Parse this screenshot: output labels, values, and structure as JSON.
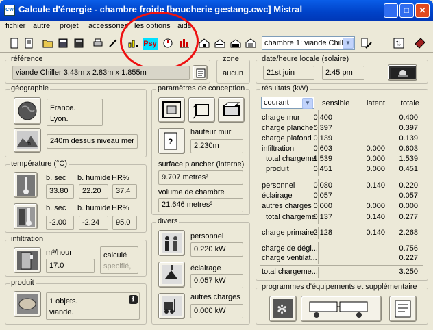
{
  "window": {
    "app_icon": "CW",
    "title": "Calcule d'énergie - chambre froide [boucherie gestang.cwc] Mistral"
  },
  "menu": [
    "fichier",
    "autre",
    "projet",
    "accessories",
    "les options",
    "aide"
  ],
  "toolbar": {
    "icons": [
      "new-icon",
      "document-icon",
      "open-folder-icon",
      "save-as-icon",
      "save-icon",
      "print-icon",
      "pencil-icon",
      "chart-icon",
      "psychrometric-icon",
      "compass-icon",
      "bar-chart-icon",
      "building-icon",
      "house-icon",
      "warehouse-icon",
      "store-icon"
    ],
    "psy_label": "Psy",
    "combo_value": "chambre 1: viande Chill",
    "right_icons": [
      "wizard-icon",
      "units-icon",
      "help-book-icon"
    ]
  },
  "reference": {
    "label": "référence",
    "value": "viande Chiller 3.43m x 2.83m x 1.855m"
  },
  "zone": {
    "label": "zone",
    "value": "aucun"
  },
  "datetime": {
    "label": "date/heure locale (solaire)",
    "date": "21st juin",
    "time": "2:45 pm"
  },
  "geographie": {
    "label": "géographie",
    "location_line1": "France.",
    "location_line2": "Lyon.",
    "altitude": "240m dessus niveau mer"
  },
  "temperature": {
    "label": "température (°C)",
    "outdoor": {
      "bsec_label": "b. sec",
      "bhum_label": "b. humide",
      "hr_label": "HR%",
      "bsec": "33.80",
      "bhum": "22.20",
      "hr": "37.4"
    },
    "indoor": {
      "bsec_label": "b. sec",
      "bhum_label": "b. humide",
      "hr_label": "HR%",
      "bsec": "-2.00",
      "bhum": "-2.24",
      "hr": "95.0"
    }
  },
  "infiltration": {
    "label": "infiltration",
    "unit_label": "m³/hour",
    "value": "17.0",
    "mode_line1": "calculé",
    "mode_line2": "specifié,"
  },
  "produit": {
    "label": "produit",
    "line1": "1 objets.",
    "line2": "viande.",
    "info_icon": "ℹ"
  },
  "conception": {
    "label": "paramètres de conception",
    "hauteur_label": "hauteur mur",
    "hauteur_value": "2.230m",
    "surface_label": "surface plancher (interne)",
    "surface_value": "9.707 metres²",
    "volume_label": "volume de chambre",
    "volume_value": "21.646 metres³"
  },
  "divers": {
    "label": "divers",
    "personnel_label": "personnel",
    "personnel_value": "0.220 kW",
    "eclairage_label": "éclairage",
    "eclairage_value": "0.057 kW",
    "autres_label": "autres charges",
    "autres_value": "0.000 kW"
  },
  "resultats": {
    "label": "résultats (kW)",
    "mode": "courant",
    "headers": [
      "sensible",
      "latent",
      "totale"
    ],
    "rows1": [
      {
        "name": "charge mur",
        "s": "0.400",
        "l": "",
        "t": "0.400"
      },
      {
        "name": "charge plancher",
        "s": "0.397",
        "l": "",
        "t": "0.397"
      },
      {
        "name": "charge plafond",
        "s": "0.139",
        "l": "",
        "t": "0.139"
      },
      {
        "name": "infiltration",
        "s": "0.603",
        "l": "0.000",
        "t": "0.603"
      },
      {
        "name": "total chargeme...",
        "s": "1.539",
        "l": "0.000",
        "t": "1.539"
      },
      {
        "name": "produit",
        "s": "0.451",
        "l": "0.000",
        "t": "0.451"
      }
    ],
    "rows2": [
      {
        "name": "personnel",
        "s": "0.080",
        "l": "0.140",
        "t": "0.220"
      },
      {
        "name": "éclairage",
        "s": "0.057",
        "l": "",
        "t": "0.057"
      },
      {
        "name": "autres charges",
        "s": "0.000",
        "l": "0.000",
        "t": "0.000"
      },
      {
        "name": "total chargeme...",
        "s": "0.137",
        "l": "0.140",
        "t": "0.277"
      }
    ],
    "primaire": {
      "name": "charge primaire",
      "s": "2.128",
      "l": "0.140",
      "t": "2.268"
    },
    "rows3": [
      {
        "name": "charge de dégi...",
        "t": "0.756"
      },
      {
        "name": "charge ventilat...",
        "t": "0.227"
      }
    ],
    "total": {
      "name": "total chargeme...",
      "t": "3.250"
    }
  },
  "programmes": {
    "label": "programmes d'équipements et supplémentaire"
  }
}
